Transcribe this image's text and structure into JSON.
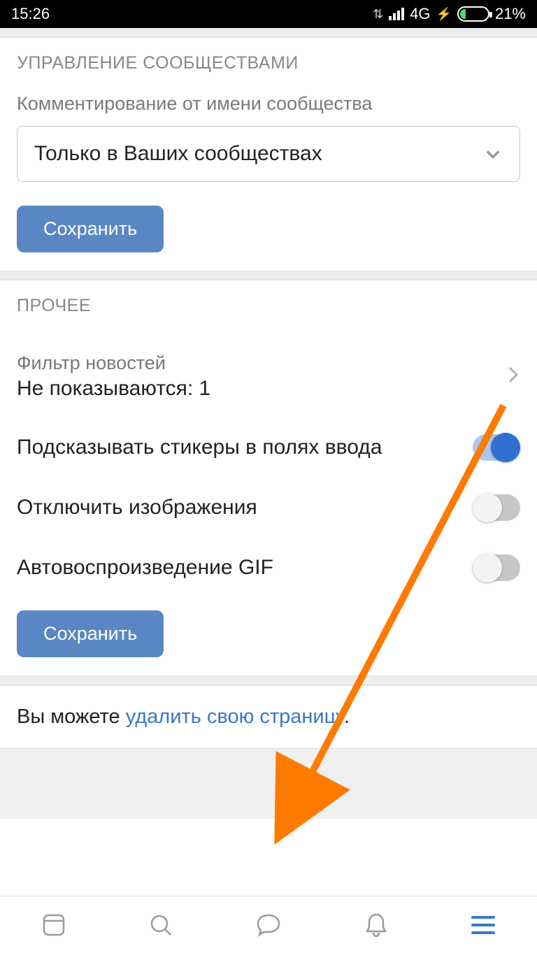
{
  "status": {
    "time": "15:26",
    "network": "4G",
    "battery_pct": "21%"
  },
  "section1": {
    "header": "УПРАВЛЕНИЕ СООБЩЕСТВАМИ",
    "field_label": "Комментирование от имени сообщества",
    "dropdown_value": "Только в Ваших сообществах",
    "save_label": "Сохранить"
  },
  "section2": {
    "header": "ПРОЧЕЕ",
    "filter_label": "Фильтр новостей",
    "filter_value": "Не показываются: 1",
    "toggle1_label": "Подсказывать стикеры в полях ввода",
    "toggle1_on": true,
    "toggle2_label": "Отключить изображения",
    "toggle2_on": false,
    "toggle3_label": "Автовоспроизведение GIF",
    "toggle3_on": false,
    "save_label": "Сохранить"
  },
  "delete": {
    "prefix": "Вы можете ",
    "link": "удалить свою страницу",
    "suffix": "."
  }
}
